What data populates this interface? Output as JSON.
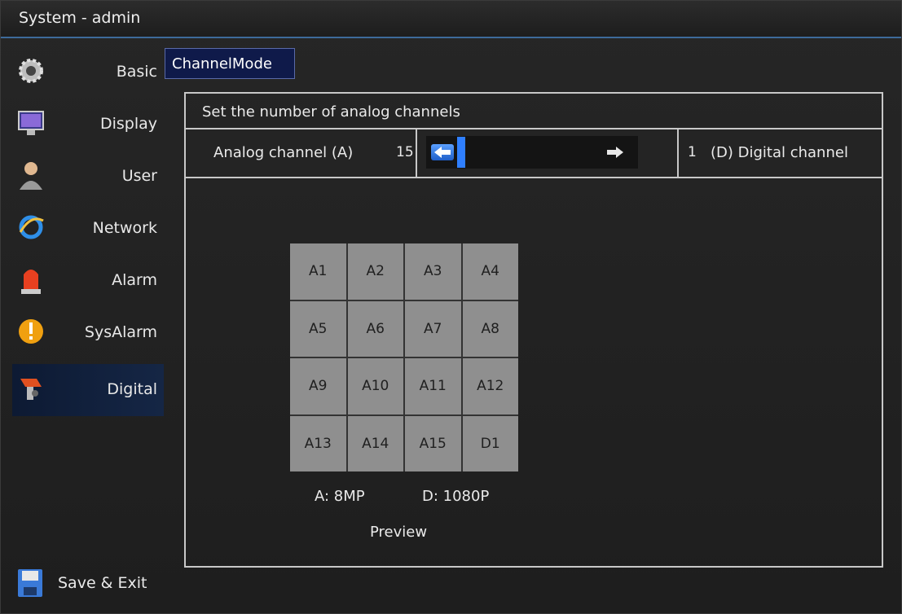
{
  "window": {
    "title": "System - admin"
  },
  "sidebar": {
    "items": [
      {
        "label": "Basic",
        "icon": "gear-icon"
      },
      {
        "label": "Display",
        "icon": "monitor-icon"
      },
      {
        "label": "User",
        "icon": "user-icon"
      },
      {
        "label": "Network",
        "icon": "network-icon"
      },
      {
        "label": "Alarm",
        "icon": "alarm-light-icon"
      },
      {
        "label": "SysAlarm",
        "icon": "warning-icon"
      },
      {
        "label": "Digital",
        "icon": "digital-camera-icon",
        "active": true
      }
    ],
    "save_label": "Save & Exit"
  },
  "tab": {
    "label": "ChannelMode"
  },
  "panel": {
    "header": "Set the number of analog channels",
    "analog_label": "Analog channel (A)",
    "analog_count": "15",
    "digital_count": "1",
    "digital_label": "(D)  Digital channel",
    "slider_value_fraction": 0.06,
    "grid_cells": [
      "A1",
      "A2",
      "A3",
      "A4",
      "A5",
      "A6",
      "A7",
      "A8",
      "A9",
      "A10",
      "A11",
      "A12",
      "A13",
      "A14",
      "A15",
      "D1"
    ],
    "resolution_a": "A:  8MP",
    "resolution_d": "D:  1080P",
    "preview_label": "Preview"
  },
  "colors": {
    "accent": "#2f7fff",
    "tab_bg": "#0f1a4a",
    "active_item": "#152645",
    "cell": "#8f8f8f"
  }
}
